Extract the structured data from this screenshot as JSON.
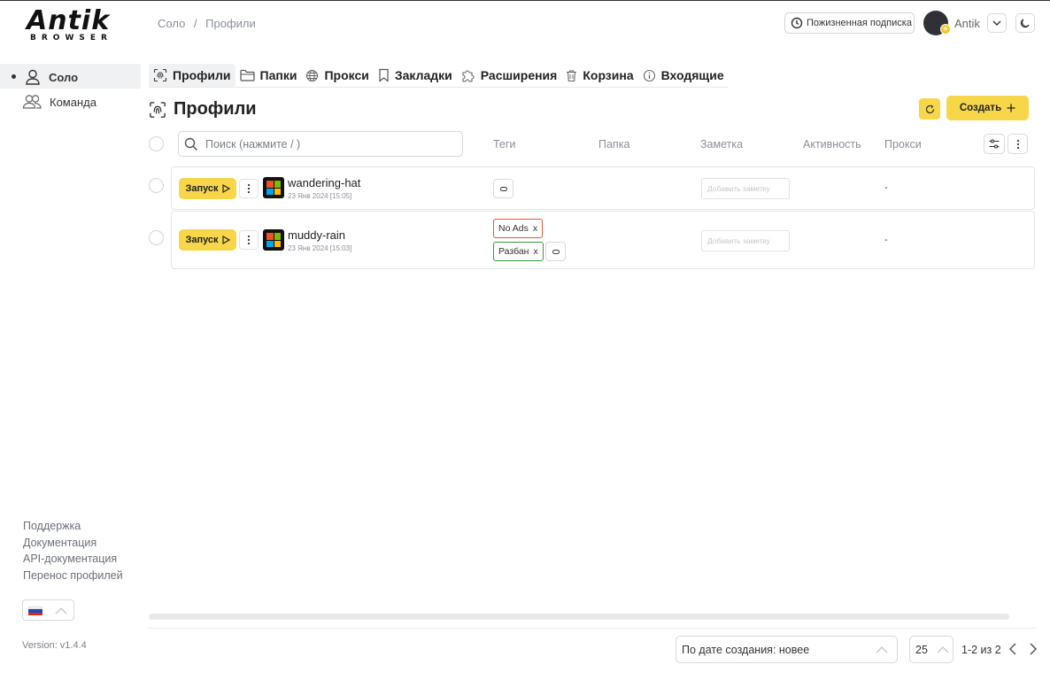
{
  "logo": {
    "main": "Antik",
    "sub": "BROWSER"
  },
  "breadcrumb": [
    "Соло",
    "/",
    "Профили"
  ],
  "header": {
    "subscription_label": "Пожизненная подписка",
    "username": "Antik"
  },
  "sidebar": {
    "items": [
      {
        "label": "Соло",
        "icon": "user-icon",
        "active": true
      },
      {
        "label": "Команда",
        "icon": "users-icon",
        "active": false
      }
    ],
    "links": [
      "Поддержка",
      "Документация",
      "API-документация",
      "Перенос профилей"
    ],
    "version": "Version: v1.4.4"
  },
  "tabs": [
    {
      "label": "Профили",
      "icon": "fingerprint-icon",
      "active": true
    },
    {
      "label": "Папки",
      "icon": "folder-icon"
    },
    {
      "label": "Прокси",
      "icon": "globe-icon"
    },
    {
      "label": "Закладки",
      "icon": "bookmark-icon"
    },
    {
      "label": "Расширения",
      "icon": "puzzle-icon"
    },
    {
      "label": "Корзина",
      "icon": "trash-icon"
    },
    {
      "label": "Входящие",
      "icon": "info-icon"
    }
  ],
  "page": {
    "title": "Профили",
    "create_label": "Создать"
  },
  "table": {
    "search_placeholder": "Поиск (нажмите / )",
    "columns": [
      "Теги",
      "Папка",
      "Заметка",
      "Активность",
      "Прокси"
    ],
    "rows": [
      {
        "launch_label": "Запуск",
        "name": "wandering-hat",
        "date": "23 Янв 2024 [15:05]",
        "tags": [],
        "note_placeholder": "Добавить заметку",
        "proxy": "-"
      },
      {
        "launch_label": "Запуск",
        "name": "muddy-rain",
        "date": "23 Янв 2024 [15:03]",
        "tags": [
          {
            "label": "No Ads",
            "remove": "x",
            "color": "#e8562f"
          },
          {
            "label": "Разбан",
            "remove": "x",
            "color": "#3a9a3a"
          }
        ],
        "note_placeholder": "Добавить заметку",
        "proxy": "-"
      }
    ]
  },
  "footer": {
    "sort_label": "По дате создания: новее",
    "per_page": "25",
    "pagination": "1-2 из 2"
  },
  "colors": {
    "accent": "#f7d64a",
    "text": "#222222",
    "muted": "#8a8f99"
  }
}
